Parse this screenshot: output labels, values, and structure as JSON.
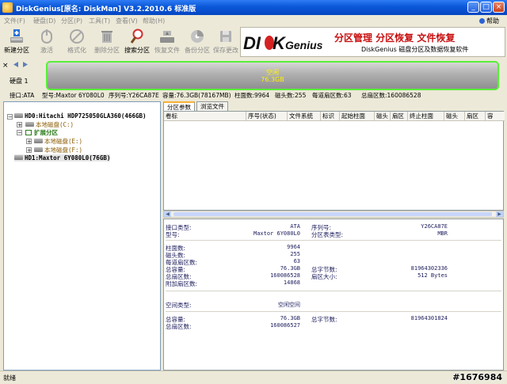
{
  "window": {
    "title": "DiskGenius[原名: DiskMan] V3.2.2010.6 标准版",
    "buttons": [
      "_",
      "□",
      "×"
    ]
  },
  "menu": {
    "items": [
      "文件(F)",
      "硬盘(D)",
      "分区(P)",
      "工具(T)",
      "查看(V)",
      "帮助(H)"
    ],
    "help_label": "帮助"
  },
  "toolbar": {
    "buttons": [
      {
        "label": "新建分区",
        "icon": "new-partition-icon",
        "enabled": true
      },
      {
        "label": "激活",
        "icon": "activate-icon",
        "enabled": false
      },
      {
        "label": "格式化",
        "icon": "format-icon",
        "enabled": false
      },
      {
        "label": "删除分区",
        "icon": "delete-partition-icon",
        "enabled": false
      },
      {
        "label": "搜索分区",
        "icon": "search-partition-icon",
        "enabled": true
      },
      {
        "label": "恢复文件",
        "icon": "recover-files-icon",
        "enabled": false
      },
      {
        "label": "备份分区",
        "icon": "backup-partition-icon",
        "enabled": false
      },
      {
        "label": "保存更改",
        "icon": "save-changes-icon",
        "enabled": false
      }
    ]
  },
  "banner": {
    "logo_a": "DI",
    "logo_b": "K",
    "logo_c": "Genius",
    "line1": "分区管理 分区恢复 文件恢复",
    "line2": "DiskGenius 磁盘分区及数据恢复软件"
  },
  "disk": {
    "label": "硬盘 1",
    "bar_line1": "空闲",
    "bar_line2": "76.3GB",
    "bar_color": "#59ef39",
    "info": [
      "接口:ATA",
      "型号:Maxtor 6Y080L0",
      "序列号:Y26CA87E",
      "容量:76.3GB(78167MB)",
      "柱面数:9964",
      "磁头数:255",
      "每道扇区数:63",
      "总扇区数:160086528"
    ]
  },
  "tree": {
    "hd0": "HD0:Hitachi HDP725050GLA360(466GB)",
    "local_c": "本地磁盘(C:)",
    "extended": "扩展分区",
    "local_e": "本地磁盘(E:)",
    "local_f": "本地磁盘(F:)",
    "hd1": "HD1:Maxtor 6Y080L0(76GB)"
  },
  "tabs": [
    "分区参数",
    "浏览文件"
  ],
  "columns": [
    "卷标",
    "序号(状态)",
    "文件系统",
    "标识",
    "起始柱面",
    "磁头",
    "扇区",
    "终止柱面",
    "磁头",
    "扇区",
    "容"
  ],
  "details": {
    "group1": [
      {
        "label": "接口类型:",
        "value": "ATA",
        "label2": "序列号:",
        "value2": "Y26CA87E"
      },
      {
        "label": "型号:",
        "value": "Maxtor 6Y080L0",
        "label2": "分区表类型:",
        "value2": "MBR"
      }
    ],
    "group2": [
      {
        "label": "柱面数:",
        "value": "9964"
      },
      {
        "label": "磁头数:",
        "value": "255"
      },
      {
        "label": "每道扇区数:",
        "value": "63"
      },
      {
        "label": "总容量:",
        "value": "76.3GB",
        "label2": "总字节数:",
        "value2": "81964302336"
      },
      {
        "label": "总扇区数:",
        "value": "160086528",
        "label2": "扇区大小:",
        "value2": "512 Bytes"
      },
      {
        "label": "附加扇区数:",
        "value": "14868"
      }
    ],
    "group3": [
      {
        "label": "空间类型:",
        "value": "空闲空间"
      }
    ],
    "group4": [
      {
        "label": "总容量:",
        "value": "76.3GB",
        "label2": "总字节数:",
        "value2": "81964301824"
      },
      {
        "label": "总扇区数:",
        "value": "160086527"
      }
    ]
  },
  "status": {
    "text": "就绪",
    "watermark": "#1676984"
  }
}
